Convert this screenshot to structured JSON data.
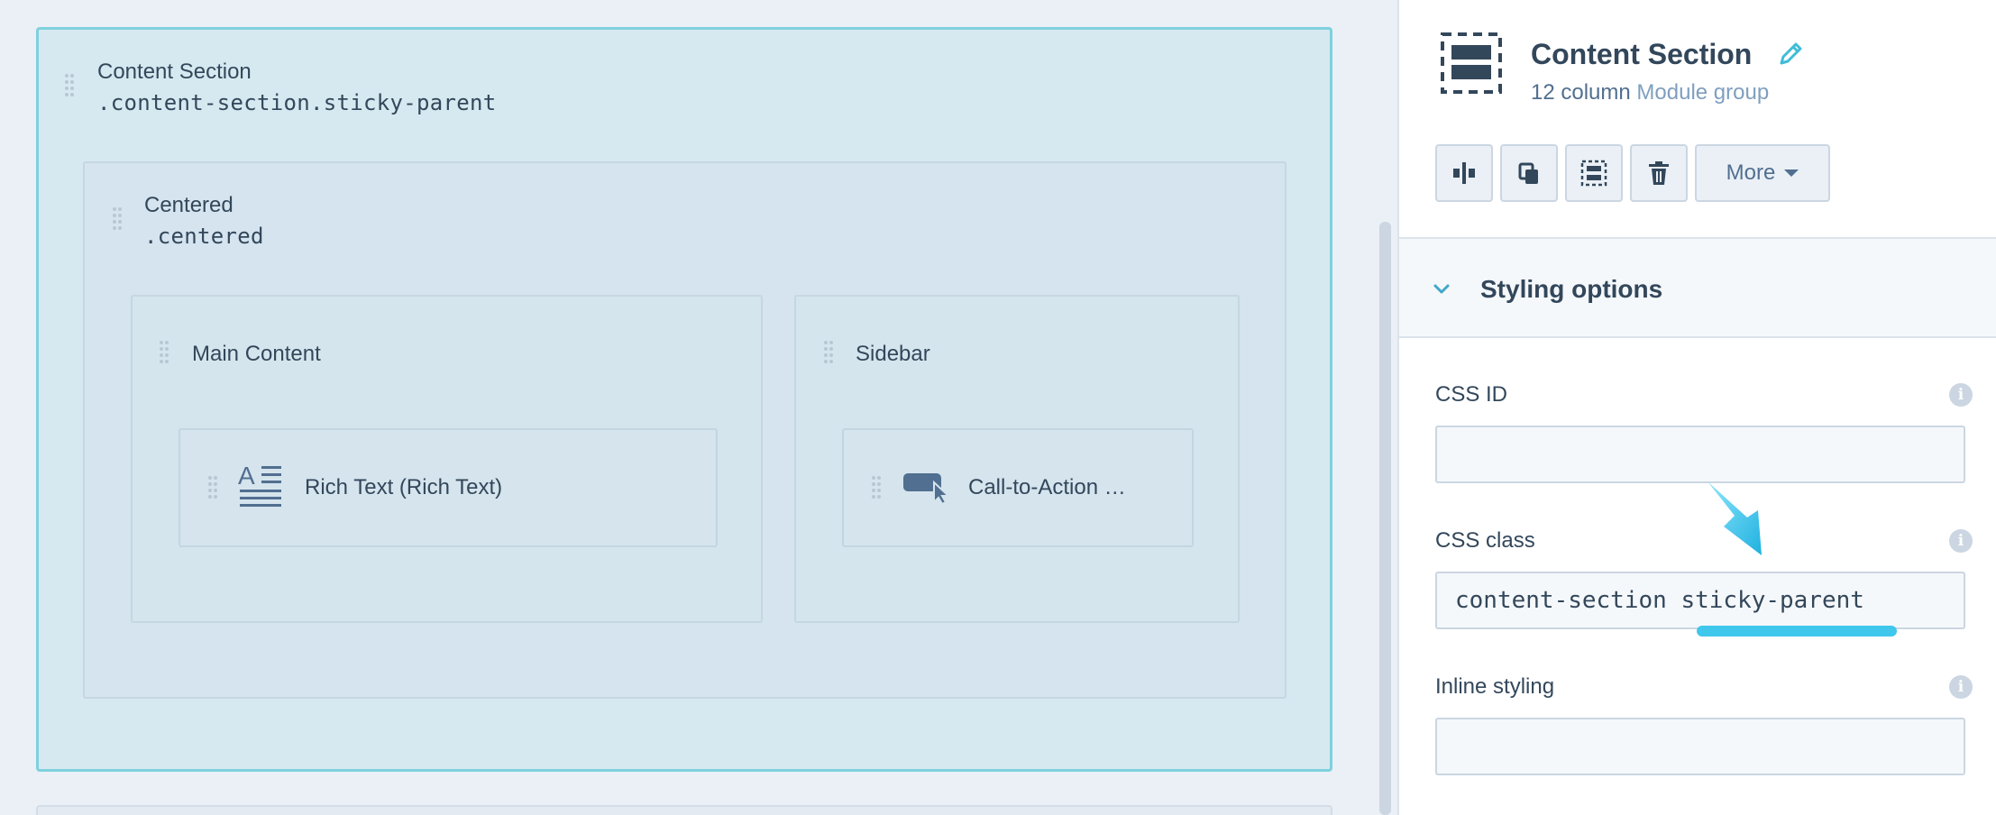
{
  "canvas": {
    "content_section": {
      "name": "Content Section",
      "css_class": ".content-section.sticky-parent"
    },
    "centered": {
      "name": "Centered",
      "css_class": ".centered"
    },
    "main_content": {
      "name": "Main Content"
    },
    "sidebar": {
      "name": "Sidebar"
    },
    "rich_text_module": {
      "label": "Rich Text (Rich Text)",
      "icon": "rich-text-icon"
    },
    "cta_module": {
      "label": "Call-to-Action …",
      "icon": "cta-icon"
    }
  },
  "inspector": {
    "title": "Content Section",
    "subtitle_prefix": "12 column",
    "subtitle_link": "Module group",
    "toolbar": {
      "split_icon": "split-column-icon",
      "clone_icon": "clone-icon",
      "wrap_icon": "wrap-group-icon",
      "delete_icon": "trash-icon",
      "more_label": "More"
    },
    "styling": {
      "title": "Styling options",
      "css_id": {
        "label": "CSS ID",
        "value": "",
        "placeholder": ""
      },
      "css_class": {
        "label": "CSS class",
        "value": "content-section sticky-parent"
      },
      "inline_styling": {
        "label": "Inline styling",
        "value": ""
      }
    }
  },
  "colors": {
    "selected_border": "#7fd1de",
    "accent_arrow": "#3fc7ec",
    "text_primary": "#33475b",
    "link": "#7f9fbf"
  }
}
